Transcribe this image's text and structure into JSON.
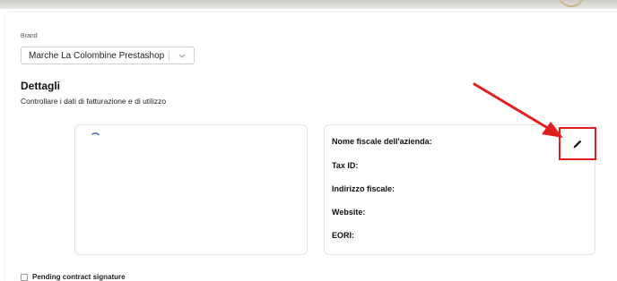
{
  "brand": {
    "label": "Brand",
    "selected": "Marche La Colombine Prestashop"
  },
  "details": {
    "title": "Dettagli",
    "subtitle": "Controllare i dati di fatturazione e di utilizzo"
  },
  "billing_fields": [
    "Nome fiscale dell'azienda:",
    "Tax ID:",
    "Indirizzo fiscale:",
    "Website:",
    "EORI:"
  ],
  "edit_button": {
    "icon": "pencil-icon"
  },
  "annotation": {
    "color": "#e02020"
  },
  "pending": {
    "label": "Pending contract signature",
    "checked": false
  }
}
